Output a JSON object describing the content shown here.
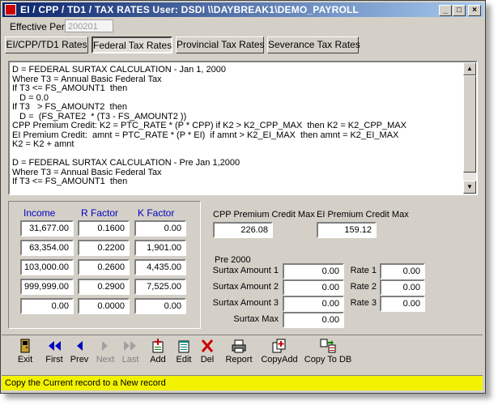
{
  "window": {
    "title": "EI / CPP / TD1 / TAX RATES  User: DSDI  \\\\DAYBREAK1\\DEMO_PAYROLL",
    "minimize": "_",
    "maximize": "□",
    "close": "×"
  },
  "effective_period": {
    "label": "Effective Period",
    "value": "200201"
  },
  "tabs": [
    {
      "label": "EI/CPP/TD1 Rates",
      "active": false
    },
    {
      "label": "Federal Tax Rates",
      "active": true
    },
    {
      "label": "Provincial Tax Rates",
      "active": false
    },
    {
      "label": "Severance Tax Rates",
      "active": false
    }
  ],
  "formula_lines": [
    "D = FEDERAL SURTAX CALCULATION - Jan 1, 2000",
    "Where T3 = Annual Basic Federal Tax",
    "If T3 <= FS_AMOUNT1  then",
    "   D = 0.0",
    "If T3   > FS_AMOUNT2  then",
    "   D =  (FS_RATE2  * (T3 - FS_AMOUNT2 ))",
    "CPP Premium Credit: K2 = PTC_RATE * (P * CPP) if K2 > K2_CPP_MAX  then K2 = K2_CPP_MAX",
    "EI Premium Credit:  amnt = PTC_RATE * (P * EI)  if amnt > K2_EI_MAX  then amnt = K2_EI_MAX",
    "K2 = K2 + amnt",
    "",
    "D = FEDERAL SURTAX CALCULATION - Pre Jan 1,2000",
    "Where T3 = Annual Basic Federal Tax",
    "If T3 <= FS_AMOUNT1  then"
  ],
  "rates_table": {
    "headers": {
      "income": "Income",
      "rfactor": "R Factor",
      "kfactor": "K Factor"
    },
    "rows": [
      {
        "income": "31,677.00",
        "rfactor": "0.1600",
        "kfactor": "0.00"
      },
      {
        "income": "63,354.00",
        "rfactor": "0.2200",
        "kfactor": "1,901.00"
      },
      {
        "income": "103,000.00",
        "rfactor": "0.2600",
        "kfactor": "4,435.00"
      },
      {
        "income": "999,999.00",
        "rfactor": "0.2900",
        "kfactor": "7,525.00"
      },
      {
        "income": "0.00",
        "rfactor": "0.0000",
        "kfactor": "0.00"
      }
    ]
  },
  "credits": {
    "cpp_label": "CPP Premium Credit Max",
    "cpp_value": "226.08",
    "ei_label": "EI Premium Credit Max",
    "ei_value": "159.12"
  },
  "pre2000": {
    "label": "Pre 2000",
    "surtax_amounts": [
      {
        "label": "Surtax Amount 1",
        "value": "0.00"
      },
      {
        "label": "Surtax Amount 2",
        "value": "0.00"
      },
      {
        "label": "Surtax Amount 3",
        "value": "0.00"
      }
    ],
    "surtax_max": {
      "label": "Surtax Max",
      "value": "0.00"
    },
    "rates": [
      {
        "label": "Rate 1",
        "value": "0.00"
      },
      {
        "label": "Rate 2",
        "value": "0.00"
      },
      {
        "label": "Rate 3",
        "value": "0.00"
      }
    ]
  },
  "toolbar": {
    "exit": "Exit",
    "first": "First",
    "prev": "Prev",
    "next": "Next",
    "last": "Last",
    "add": "Add",
    "edit": "Edit",
    "del": "Del",
    "report": "Report",
    "copyadd": "CopyAdd",
    "copytodb": "Copy To DB"
  },
  "status": "Copy the Current record to a New record",
  "colors": {
    "title_start": "#0a246a",
    "title_end": "#a6caf0",
    "status_bg": "#f2f200",
    "header_text": "#0000c0",
    "nav_arrow": "#0000c0",
    "delete": "#cc0000"
  }
}
